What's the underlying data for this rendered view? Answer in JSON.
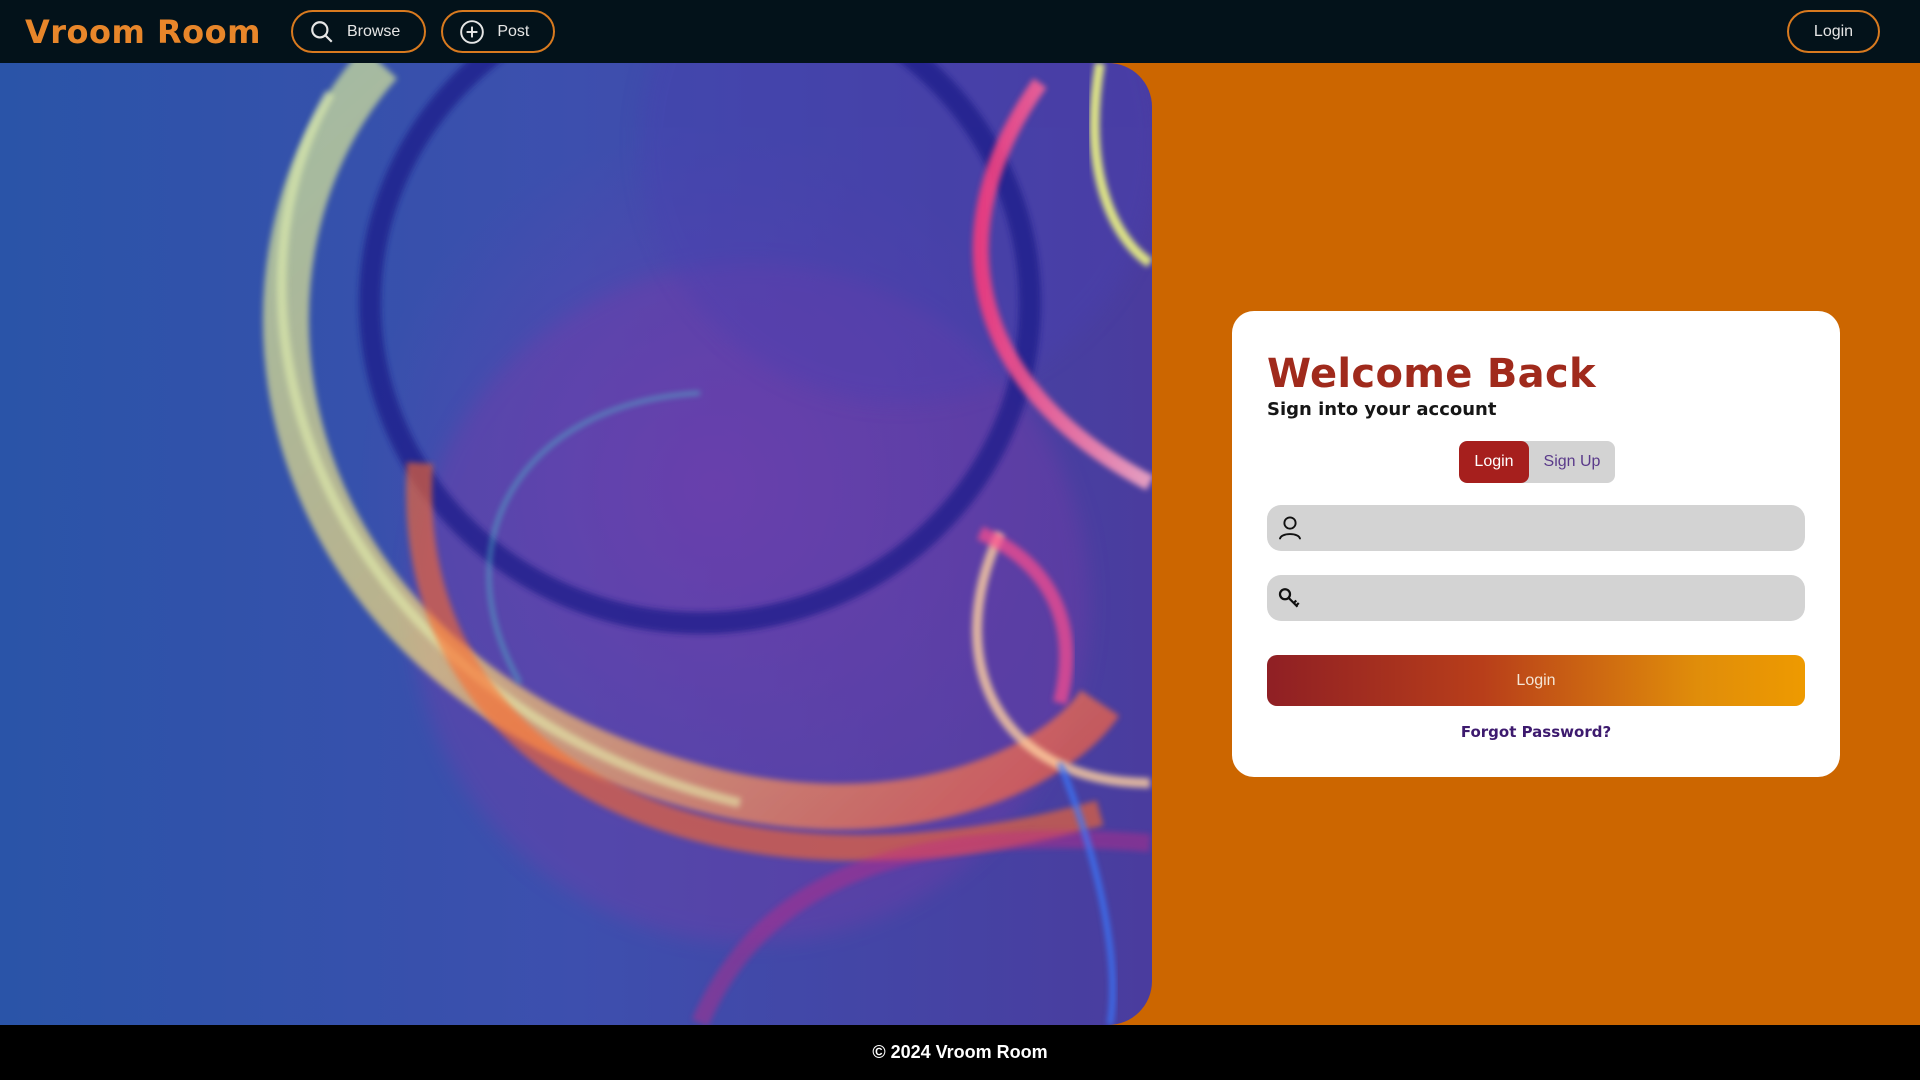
{
  "nav": {
    "brand": "Vroom Room",
    "browse_label": "Browse",
    "post_label": "Post",
    "login_label": "Login"
  },
  "card": {
    "title": "Welcome Back",
    "subtitle": "Sign into your account",
    "tabs": [
      {
        "label": "Login",
        "active": true
      },
      {
        "label": "Sign Up",
        "active": false
      }
    ],
    "username": {
      "value": "",
      "placeholder": ""
    },
    "password": {
      "value": "",
      "placeholder": ""
    },
    "submit_label": "Login",
    "forgot_label": "Forgot Password?"
  },
  "footer": {
    "text": "© 2024 Vroom Room"
  },
  "colors": {
    "accent": "#e8862a",
    "page_background": "#cc6600",
    "navbar": "#03121a",
    "title": "#a02a1c",
    "tab_active": "#a61f1d"
  }
}
